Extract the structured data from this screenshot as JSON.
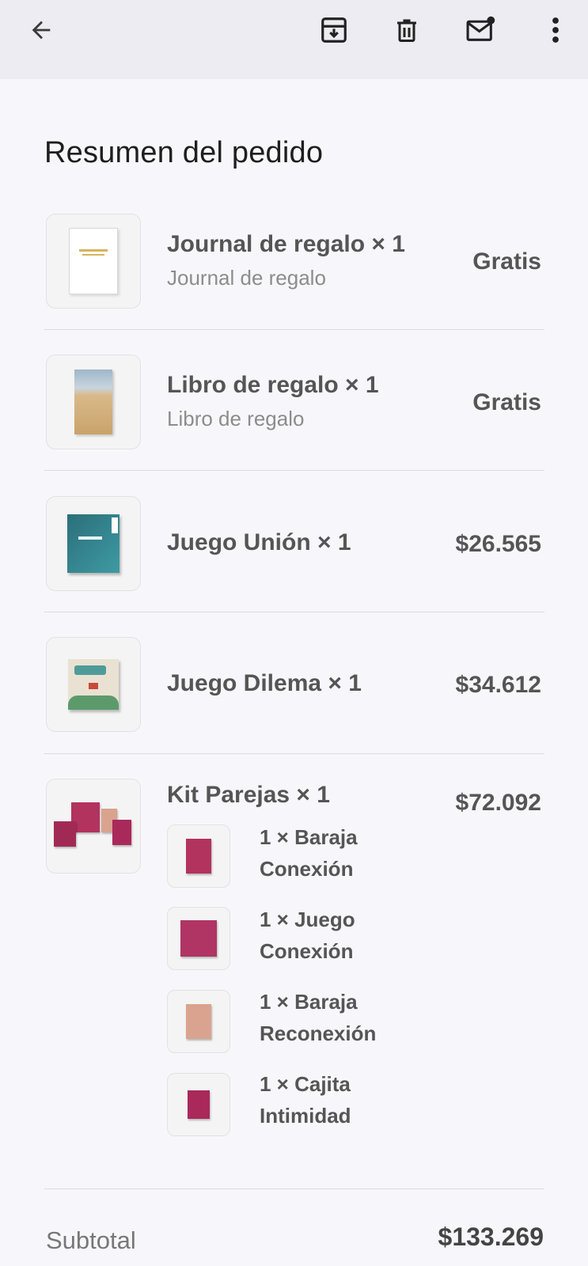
{
  "toolbar": {
    "back_icon": "arrow-left-icon",
    "archive_icon": "archive-icon",
    "delete_icon": "trash-icon",
    "mark_unread_icon": "mail-unread-icon",
    "more_icon": "more-vert-icon"
  },
  "order": {
    "title": "Resumen del pedido",
    "items": [
      {
        "name": "Journal de regalo × 1",
        "subtitle": "Journal de regalo",
        "price": "Gratis"
      },
      {
        "name": "Libro de regalo × 1",
        "subtitle": "Libro de regalo",
        "price": "Gratis"
      },
      {
        "name": "Juego Unión × 1",
        "price": "$26.565"
      },
      {
        "name": "Juego Dilema × 1",
        "price": "$34.612"
      },
      {
        "name": "Kit Parejas × 1",
        "price": "$72.092",
        "components": [
          {
            "line1": "1 × Baraja",
            "line2": "Conexión"
          },
          {
            "line1": "1 × Juego",
            "line2": "Conexión"
          },
          {
            "line1": "1 × Baraja",
            "line2": "Reconexión"
          },
          {
            "line1": "1 × Cajita",
            "line2": "Intimidad"
          }
        ]
      }
    ],
    "subtotal_label": "Subtotal",
    "subtotal_value": "$133.269"
  },
  "colors": {
    "appbar_bg": "#ececf2",
    "page_bg": "#f7f7fb",
    "union_box": "#2f7d86",
    "kit_box": "#a12a55"
  }
}
